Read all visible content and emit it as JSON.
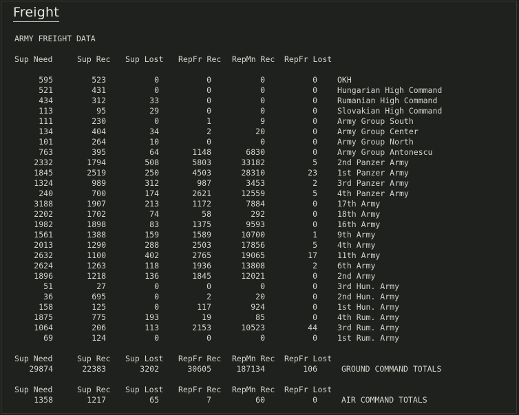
{
  "window": {
    "title": "Freight"
  },
  "section_title": "ARMY FREIGHT DATA",
  "headers": [
    "Sup Need",
    "Sup Rec",
    "Sup Lost",
    "RepFr Rec",
    "RepMn Rec",
    "RepFr Lost"
  ],
  "rows": [
    {
      "v": [
        "595",
        "523",
        "0",
        "0",
        "0",
        "0"
      ],
      "name": "OKH"
    },
    {
      "v": [
        "521",
        "431",
        "0",
        "0",
        "0",
        "0"
      ],
      "name": "Hungarian High Command"
    },
    {
      "v": [
        "434",
        "312",
        "33",
        "0",
        "0",
        "0"
      ],
      "name": "Rumanian High Command"
    },
    {
      "v": [
        "113",
        "95",
        "29",
        "0",
        "0",
        "0"
      ],
      "name": "Slovakian High Command"
    },
    {
      "v": [
        "111",
        "230",
        "0",
        "1",
        "9",
        "0"
      ],
      "name": "Army Group South"
    },
    {
      "v": [
        "134",
        "404",
        "34",
        "2",
        "20",
        "0"
      ],
      "name": "Army Group Center"
    },
    {
      "v": [
        "101",
        "264",
        "10",
        "0",
        "0",
        "0"
      ],
      "name": "Army Group North"
    },
    {
      "v": [
        "763",
        "395",
        "64",
        "1148",
        "6830",
        "0"
      ],
      "name": "Army Group Antonescu"
    },
    {
      "v": [
        "2332",
        "1794",
        "508",
        "5803",
        "33182",
        "5"
      ],
      "name": "2nd Panzer Army"
    },
    {
      "v": [
        "1845",
        "2519",
        "250",
        "4503",
        "28310",
        "23"
      ],
      "name": "1st Panzer Army"
    },
    {
      "v": [
        "1324",
        "989",
        "312",
        "987",
        "3453",
        "2"
      ],
      "name": "3rd Panzer Army"
    },
    {
      "v": [
        "240",
        "700",
        "174",
        "2621",
        "12559",
        "5"
      ],
      "name": "4th Panzer Army"
    },
    {
      "v": [
        "3188",
        "1907",
        "213",
        "1172",
        "7884",
        "0"
      ],
      "name": "17th Army"
    },
    {
      "v": [
        "2202",
        "1702",
        "74",
        "58",
        "292",
        "0"
      ],
      "name": "18th Army"
    },
    {
      "v": [
        "1982",
        "1898",
        "83",
        "1375",
        "9593",
        "0"
      ],
      "name": "16th Army"
    },
    {
      "v": [
        "1561",
        "1388",
        "159",
        "1589",
        "10700",
        "1"
      ],
      "name": "9th Army"
    },
    {
      "v": [
        "2013",
        "1290",
        "288",
        "2503",
        "17856",
        "5"
      ],
      "name": "4th Army"
    },
    {
      "v": [
        "2632",
        "1100",
        "402",
        "2765",
        "19065",
        "17"
      ],
      "name": "11th Army"
    },
    {
      "v": [
        "2624",
        "1263",
        "118",
        "1936",
        "13808",
        "2"
      ],
      "name": "6th Army"
    },
    {
      "v": [
        "1896",
        "1218",
        "136",
        "1845",
        "12021",
        "0"
      ],
      "name": "2nd Army"
    },
    {
      "v": [
        "51",
        "27",
        "0",
        "0",
        "0",
        "0"
      ],
      "name": "3rd Hun. Army"
    },
    {
      "v": [
        "36",
        "695",
        "0",
        "2",
        "20",
        "0"
      ],
      "name": "2nd Hun. Army"
    },
    {
      "v": [
        "158",
        "125",
        "0",
        "117",
        "924",
        "0"
      ],
      "name": "1st Hun. Army"
    },
    {
      "v": [
        "1875",
        "775",
        "193",
        "19",
        "85",
        "0"
      ],
      "name": "4th Rum. Army"
    },
    {
      "v": [
        "1064",
        "206",
        "113",
        "2153",
        "10523",
        "44"
      ],
      "name": "3rd Rum. Army"
    },
    {
      "v": [
        "69",
        "124",
        "0",
        "0",
        "0",
        "0"
      ],
      "name": "1st Rum. Army"
    }
  ],
  "ground_totals": {
    "headers": [
      "Sup Need",
      "Sup Rec",
      "Sup Lost",
      "RepFr Rec",
      "RepMn Rec",
      "RepFr Lost"
    ],
    "values": [
      "29874",
      "22383",
      "3202",
      "30605",
      "187134",
      "106"
    ],
    "label": "GROUND COMMAND TOTALS"
  },
  "air_totals": {
    "headers": [
      "Sup Need",
      "Sup Rec",
      "Sup Lost",
      "RepFr Rec",
      "RepMn Rec",
      "RepFr Lost"
    ],
    "values": [
      "1358",
      "1217",
      "65",
      "7",
      "60",
      "0"
    ],
    "label": "AIR COMMAND TOTALS"
  }
}
